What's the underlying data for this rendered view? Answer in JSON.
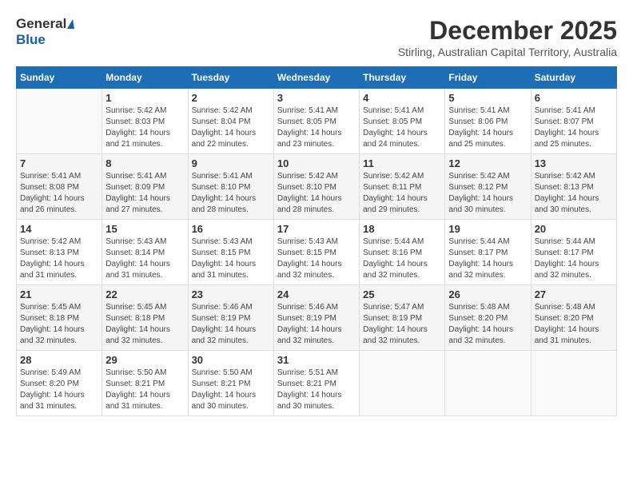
{
  "logo": {
    "general": "General",
    "blue": "Blue"
  },
  "title": "December 2025",
  "subtitle": "Stirling, Australian Capital Territory, Australia",
  "headers": [
    "Sunday",
    "Monday",
    "Tuesday",
    "Wednesday",
    "Thursday",
    "Friday",
    "Saturday"
  ],
  "weeks": [
    [
      {
        "num": "",
        "info": ""
      },
      {
        "num": "1",
        "info": "Sunrise: 5:42 AM\nSunset: 8:03 PM\nDaylight: 14 hours\nand 21 minutes."
      },
      {
        "num": "2",
        "info": "Sunrise: 5:42 AM\nSunset: 8:04 PM\nDaylight: 14 hours\nand 22 minutes."
      },
      {
        "num": "3",
        "info": "Sunrise: 5:41 AM\nSunset: 8:05 PM\nDaylight: 14 hours\nand 23 minutes."
      },
      {
        "num": "4",
        "info": "Sunrise: 5:41 AM\nSunset: 8:05 PM\nDaylight: 14 hours\nand 24 minutes."
      },
      {
        "num": "5",
        "info": "Sunrise: 5:41 AM\nSunset: 8:06 PM\nDaylight: 14 hours\nand 25 minutes."
      },
      {
        "num": "6",
        "info": "Sunrise: 5:41 AM\nSunset: 8:07 PM\nDaylight: 14 hours\nand 25 minutes."
      }
    ],
    [
      {
        "num": "7",
        "info": "Sunrise: 5:41 AM\nSunset: 8:08 PM\nDaylight: 14 hours\nand 26 minutes."
      },
      {
        "num": "8",
        "info": "Sunrise: 5:41 AM\nSunset: 8:09 PM\nDaylight: 14 hours\nand 27 minutes."
      },
      {
        "num": "9",
        "info": "Sunrise: 5:41 AM\nSunset: 8:10 PM\nDaylight: 14 hours\nand 28 minutes."
      },
      {
        "num": "10",
        "info": "Sunrise: 5:42 AM\nSunset: 8:10 PM\nDaylight: 14 hours\nand 28 minutes."
      },
      {
        "num": "11",
        "info": "Sunrise: 5:42 AM\nSunset: 8:11 PM\nDaylight: 14 hours\nand 29 minutes."
      },
      {
        "num": "12",
        "info": "Sunrise: 5:42 AM\nSunset: 8:12 PM\nDaylight: 14 hours\nand 30 minutes."
      },
      {
        "num": "13",
        "info": "Sunrise: 5:42 AM\nSunset: 8:13 PM\nDaylight: 14 hours\nand 30 minutes."
      }
    ],
    [
      {
        "num": "14",
        "info": "Sunrise: 5:42 AM\nSunset: 8:13 PM\nDaylight: 14 hours\nand 31 minutes."
      },
      {
        "num": "15",
        "info": "Sunrise: 5:43 AM\nSunset: 8:14 PM\nDaylight: 14 hours\nand 31 minutes."
      },
      {
        "num": "16",
        "info": "Sunrise: 5:43 AM\nSunset: 8:15 PM\nDaylight: 14 hours\nand 31 minutes."
      },
      {
        "num": "17",
        "info": "Sunrise: 5:43 AM\nSunset: 8:15 PM\nDaylight: 14 hours\nand 32 minutes."
      },
      {
        "num": "18",
        "info": "Sunrise: 5:44 AM\nSunset: 8:16 PM\nDaylight: 14 hours\nand 32 minutes."
      },
      {
        "num": "19",
        "info": "Sunrise: 5:44 AM\nSunset: 8:17 PM\nDaylight: 14 hours\nand 32 minutes."
      },
      {
        "num": "20",
        "info": "Sunrise: 5:44 AM\nSunset: 8:17 PM\nDaylight: 14 hours\nand 32 minutes."
      }
    ],
    [
      {
        "num": "21",
        "info": "Sunrise: 5:45 AM\nSunset: 8:18 PM\nDaylight: 14 hours\nand 32 minutes."
      },
      {
        "num": "22",
        "info": "Sunrise: 5:45 AM\nSunset: 8:18 PM\nDaylight: 14 hours\nand 32 minutes."
      },
      {
        "num": "23",
        "info": "Sunrise: 5:46 AM\nSunset: 8:19 PM\nDaylight: 14 hours\nand 32 minutes."
      },
      {
        "num": "24",
        "info": "Sunrise: 5:46 AM\nSunset: 8:19 PM\nDaylight: 14 hours\nand 32 minutes."
      },
      {
        "num": "25",
        "info": "Sunrise: 5:47 AM\nSunset: 8:19 PM\nDaylight: 14 hours\nand 32 minutes."
      },
      {
        "num": "26",
        "info": "Sunrise: 5:48 AM\nSunset: 8:20 PM\nDaylight: 14 hours\nand 32 minutes."
      },
      {
        "num": "27",
        "info": "Sunrise: 5:48 AM\nSunset: 8:20 PM\nDaylight: 14 hours\nand 31 minutes."
      }
    ],
    [
      {
        "num": "28",
        "info": "Sunrise: 5:49 AM\nSunset: 8:20 PM\nDaylight: 14 hours\nand 31 minutes."
      },
      {
        "num": "29",
        "info": "Sunrise: 5:50 AM\nSunset: 8:21 PM\nDaylight: 14 hours\nand 31 minutes."
      },
      {
        "num": "30",
        "info": "Sunrise: 5:50 AM\nSunset: 8:21 PM\nDaylight: 14 hours\nand 30 minutes."
      },
      {
        "num": "31",
        "info": "Sunrise: 5:51 AM\nSunset: 8:21 PM\nDaylight: 14 hours\nand 30 minutes."
      },
      {
        "num": "",
        "info": ""
      },
      {
        "num": "",
        "info": ""
      },
      {
        "num": "",
        "info": ""
      }
    ]
  ]
}
